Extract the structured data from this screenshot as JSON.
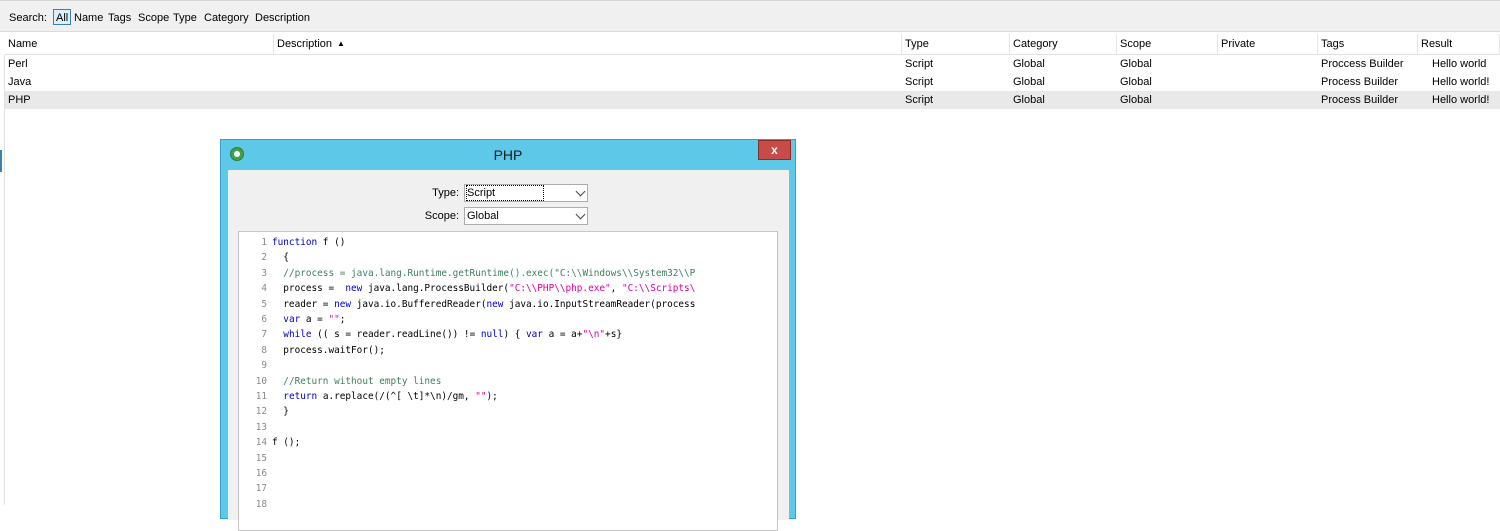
{
  "search": {
    "label": "Search:",
    "filters": [
      "All",
      "Name",
      "Tags",
      "Scope",
      "Type",
      "Category",
      "Description"
    ],
    "active_filter": "All"
  },
  "table": {
    "columns": [
      "Name",
      "Description",
      "Type",
      "Category",
      "Scope",
      "Private",
      "Tags",
      "Result"
    ],
    "sorted_column": "Description",
    "sort_direction": "ascending",
    "rows": [
      {
        "name": "Perl",
        "description": "",
        "type": "Script",
        "category": "Global",
        "scope": "Global",
        "private": "",
        "tags": "Proccess Builder",
        "result": "Hello world"
      },
      {
        "name": "Java",
        "description": "",
        "type": "Script",
        "category": "Global",
        "scope": "Global",
        "private": "",
        "tags": "Process Builder",
        "result": "Hello world!"
      },
      {
        "name": "PHP",
        "description": "",
        "type": "Script",
        "category": "Global",
        "scope": "Global",
        "private": "",
        "tags": "Process Builder",
        "result": "Hello world!"
      }
    ],
    "selected_row": 2
  },
  "dialog": {
    "title": "PHP",
    "close_label": "x",
    "type_label": "Type:",
    "type_value": "Script",
    "scope_label": "Scope:",
    "scope_value": "Global",
    "code_lines": [
      {
        "n": "1",
        "text": "function f ()"
      },
      {
        "n": "2",
        "text": "  {"
      },
      {
        "n": "3",
        "text": "  //process = java.lang.Runtime.getRuntime().exec(\"C:\\\\Windows\\\\System32\\\\P"
      },
      {
        "n": "4",
        "text": "  process =  new java.lang.ProcessBuilder(\"C:\\\\PHP\\\\php.exe\", \"C:\\\\Scripts\\"
      },
      {
        "n": "5",
        "text": "  reader = new java.io.BufferedReader(new java.io.InputStreamReader(process"
      },
      {
        "n": "6",
        "text": "  var a = \"\";"
      },
      {
        "n": "7",
        "text": "  while (( s = reader.readLine()) != null) { var a = a+\"\\n\"+s}"
      },
      {
        "n": "8",
        "text": "  process.waitFor();"
      },
      {
        "n": "9",
        "text": ""
      },
      {
        "n": "10",
        "text": "  //Return without empty lines"
      },
      {
        "n": "11",
        "text": "  return a.replace(/(^[ \\t]*\\n)/gm, \"\");"
      },
      {
        "n": "12",
        "text": "  }"
      },
      {
        "n": "13",
        "text": ""
      },
      {
        "n": "14",
        "text": "f ();"
      },
      {
        "n": "15",
        "text": ""
      },
      {
        "n": "16",
        "text": ""
      },
      {
        "n": "17",
        "text": ""
      },
      {
        "n": "18",
        "text": ""
      }
    ]
  },
  "icons": {
    "dialog": "gear-icon",
    "close": "close-icon",
    "sort": "sort-ascending-icon",
    "dropdown": "chevron-down-icon"
  },
  "colors": {
    "dialog_frame": "#5ec8e8",
    "close_button": "#c74b47",
    "keyword": "#0000c8",
    "comment": "#3f7f5f",
    "string": "#d9009e"
  }
}
